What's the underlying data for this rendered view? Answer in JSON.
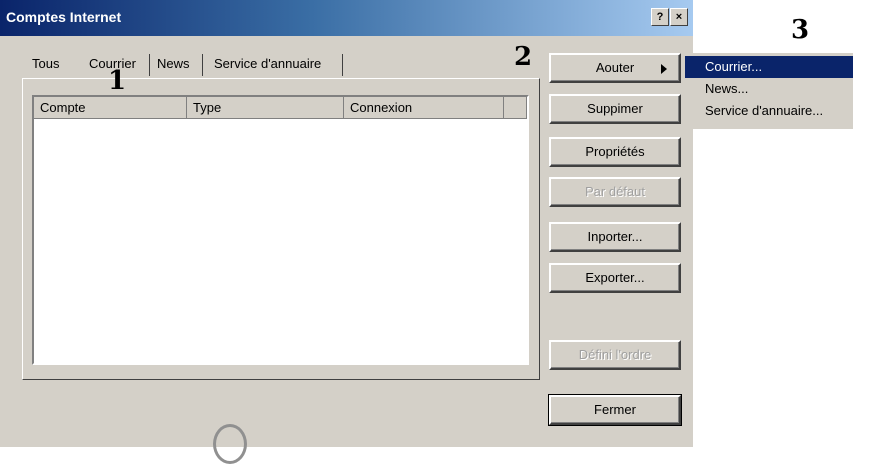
{
  "window": {
    "title": "Comptes Internet",
    "help_label": "?",
    "close_label": "×"
  },
  "tabs": [
    {
      "label": "Tous"
    },
    {
      "label": "Courrier"
    },
    {
      "label": "News"
    },
    {
      "label": "Service d'annuaire"
    }
  ],
  "listview": {
    "columns": [
      "Compte",
      "Type",
      "Connexion"
    ]
  },
  "buttons": {
    "add": "Aouter",
    "remove": "Suppimer",
    "properties": "Propriétés",
    "default": "Par défaut",
    "import": "Inporter...",
    "export": "Exporter...",
    "order": "Défini l'ordre",
    "close": "Fermer"
  },
  "menu": {
    "items": [
      "Courrier...",
      "News...",
      "Service d'annuaire..."
    ]
  },
  "annotations": {
    "step1": "1",
    "step2": "2",
    "step3": "3"
  },
  "colors": {
    "dialog_bg": "#d4d0c8",
    "titlebar": "#0a246a",
    "selection": "#0a246a"
  }
}
